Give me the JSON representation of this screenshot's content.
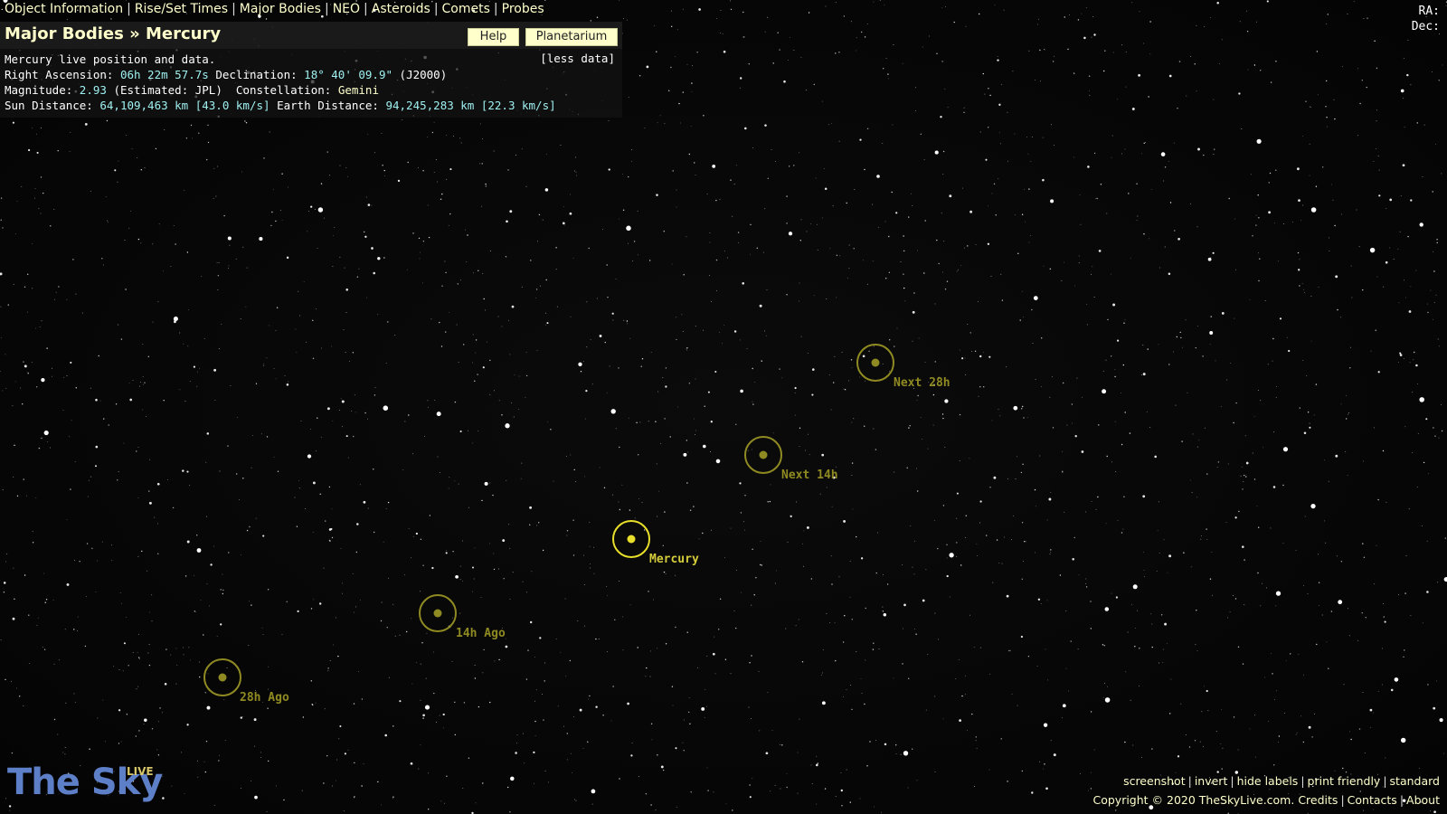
{
  "nav": {
    "items": [
      "Object Information",
      "Rise/Set Times",
      "Major Bodies",
      "NEO",
      "Asteroids",
      "Comets",
      "Probes"
    ]
  },
  "header": {
    "breadcrumb_parent": "Major Bodies",
    "breadcrumb_sep": "»",
    "breadcrumb_current": "Mercury",
    "help_label": "Help",
    "planetarium_label": "Planetarium"
  },
  "info": {
    "intro": "Mercury live position and data.",
    "less_data": "[less data]",
    "ra_label": "Right Ascension:",
    "ra_value": "06h 22m 57.7s",
    "dec_label": "Declination:",
    "dec_value": "18° 40' 09.9\"",
    "epoch": "(J2000)",
    "mag_label": "Magnitude:",
    "mag_value": "2.93",
    "mag_source": "(Estimated: JPL)",
    "const_label": "Constellation:",
    "const_value": "Gemini",
    "sun_label": "Sun Distance:",
    "sun_value": "64,109,463 km [43.0 km/s]",
    "earth_label": "Earth Distance:",
    "earth_value": "94,245,283 km [22.3 km/s]"
  },
  "coords": {
    "ra_label": "RA:",
    "dec_label": "Dec:"
  },
  "markers": {
    "main": "Mercury",
    "next14": "Next 14h",
    "next28": "Next 28h",
    "ago14": "14h Ago",
    "ago28": "28h Ago"
  },
  "colors": {
    "marker_main": "#e8df2a",
    "marker_faded": "#8f8a22",
    "accent_cyan": "#9ff0f0",
    "accent_cream": "#ffffcc",
    "logo_blue": "#5d7fc8"
  },
  "logo": {
    "text": "The Sky",
    "badge": "LIVE"
  },
  "footer": {
    "links": [
      "screenshot",
      "invert",
      "hide labels",
      "print friendly",
      "standard"
    ],
    "copyright": "Copyright © 2020 TheSkyLive.com.",
    "links2": [
      "Credits",
      "Contacts",
      "About"
    ]
  }
}
